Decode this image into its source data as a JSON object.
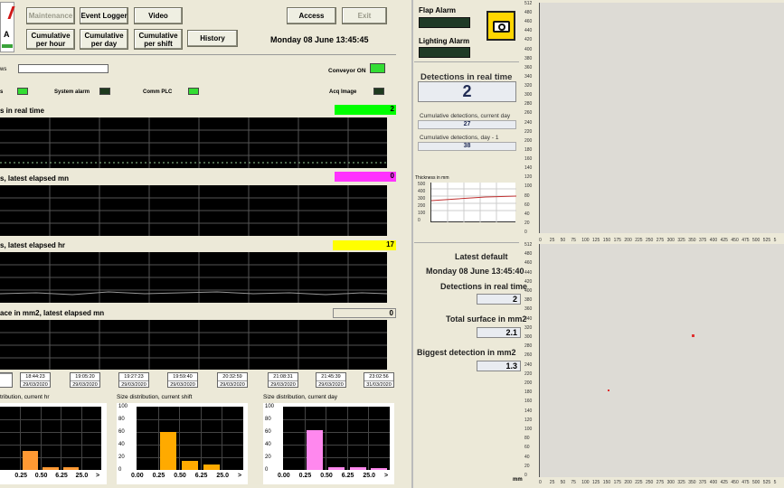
{
  "logo": {
    "text": "A"
  },
  "toolbar": {
    "maintenance": "Maintenance",
    "event_logger": "Event Logger",
    "video": "Video",
    "access": "Access",
    "exit": "Exit",
    "cum_hour": "Cumulative\nper hour",
    "cum_day": "Cumulative\nper day",
    "cum_shift": "Cumulative\nper shift",
    "history": "History",
    "datetime": "Monday 08 June  13:45:45"
  },
  "status": {
    "news_label": "ws",
    "conveyor": "Conveyor ON",
    "system_alarm": "System alarm",
    "comm_plc": "Comm PLC",
    "acq_image": "Acq Image",
    "led_left": "s"
  },
  "strips": [
    {
      "title": "s in real time",
      "value": "2",
      "color": "#00ff00"
    },
    {
      "title": "s, latest elapsed mn",
      "value": "0",
      "color": "#ff33ff"
    },
    {
      "title": "s, latest elapsed hr",
      "value": "17",
      "color": "#ffff00"
    },
    {
      "title": "ace in mm2, latest elapsed mn",
      "value": "0",
      "color": "#ece9d8"
    }
  ],
  "timeline": [
    {
      "time": "",
      "date": ""
    },
    {
      "time": "18:44:23",
      "date": "29/03/2020"
    },
    {
      "time": "19:05:20",
      "date": "29/03/2020"
    },
    {
      "time": "19:27:23",
      "date": "29/03/2020"
    },
    {
      "time": "19:59:40",
      "date": "29/03/2020"
    },
    {
      "time": "20:32:59",
      "date": "29/03/2020"
    },
    {
      "time": "21:08:31",
      "date": "29/03/2020"
    },
    {
      "time": "21:45:39",
      "date": "29/03/2020"
    },
    {
      "time": "23:02:56",
      "date": "31/03/2020"
    }
  ],
  "histograms": [
    {
      "title": "tribution, current hr",
      "color": "#ff9933",
      "values": [
        0,
        30,
        5,
        5,
        0
      ]
    },
    {
      "title": "Size distribution, current shift",
      "color": "#ffaa00",
      "values": [
        0,
        60,
        15,
        8,
        0
      ]
    },
    {
      "title": "Size distribution, current day",
      "color": "#ff88ee",
      "values": [
        0,
        63,
        5,
        5,
        3
      ]
    }
  ],
  "hist_axis": {
    "x": [
      "0.00",
      "0.25",
      "0.50",
      "6.25",
      "25.0",
      ">"
    ],
    "y": [
      "100",
      "80",
      "60",
      "40",
      "20",
      "0"
    ]
  },
  "right": {
    "flap_alarm": "Flap Alarm",
    "lighting_alarm": "Lighting Alarm",
    "detections_rt_label": "Detections in real time",
    "detections_rt_value": "2",
    "cum_day_label": "Cumulative detections, current day",
    "cum_day_value": "27",
    "cum_day1_label": "Cumulative detections, day - 1",
    "cum_day1_value": "38",
    "thickness_label": "Thickness in mm",
    "thickness_ticks": [
      "500",
      "400",
      "300",
      "200",
      "100",
      "0"
    ],
    "latest_default": "Latest default",
    "latest_datetime": "Monday 08 June  13:45:40",
    "det_rt_label": "Detections in real time",
    "det_rt_value": "2",
    "surface_label": "Total surface in mm2",
    "surface_value": "2.1",
    "biggest_label": "Biggest detection in mm2",
    "biggest_value": "1.3",
    "mm": "mm"
  },
  "image_axes": {
    "y": [
      "512",
      "480",
      "460",
      "440",
      "420",
      "400",
      "380",
      "360",
      "340",
      "320",
      "300",
      "280",
      "260",
      "240",
      "220",
      "200",
      "180",
      "160",
      "140",
      "120",
      "100",
      "80",
      "60",
      "40",
      "20",
      "0"
    ],
    "x": [
      "0",
      "25",
      "50",
      "75",
      "100",
      "125",
      "150",
      "175",
      "200",
      "225",
      "250",
      "275",
      "300",
      "325",
      "350",
      "375",
      "400",
      "425",
      "450",
      "475",
      "500",
      "525",
      "5"
    ]
  },
  "colors": {
    "led_on": "#33dd33",
    "led_off": "#1e3a1e",
    "alarm_off": "#1f3a26",
    "detection": "#e03030"
  }
}
